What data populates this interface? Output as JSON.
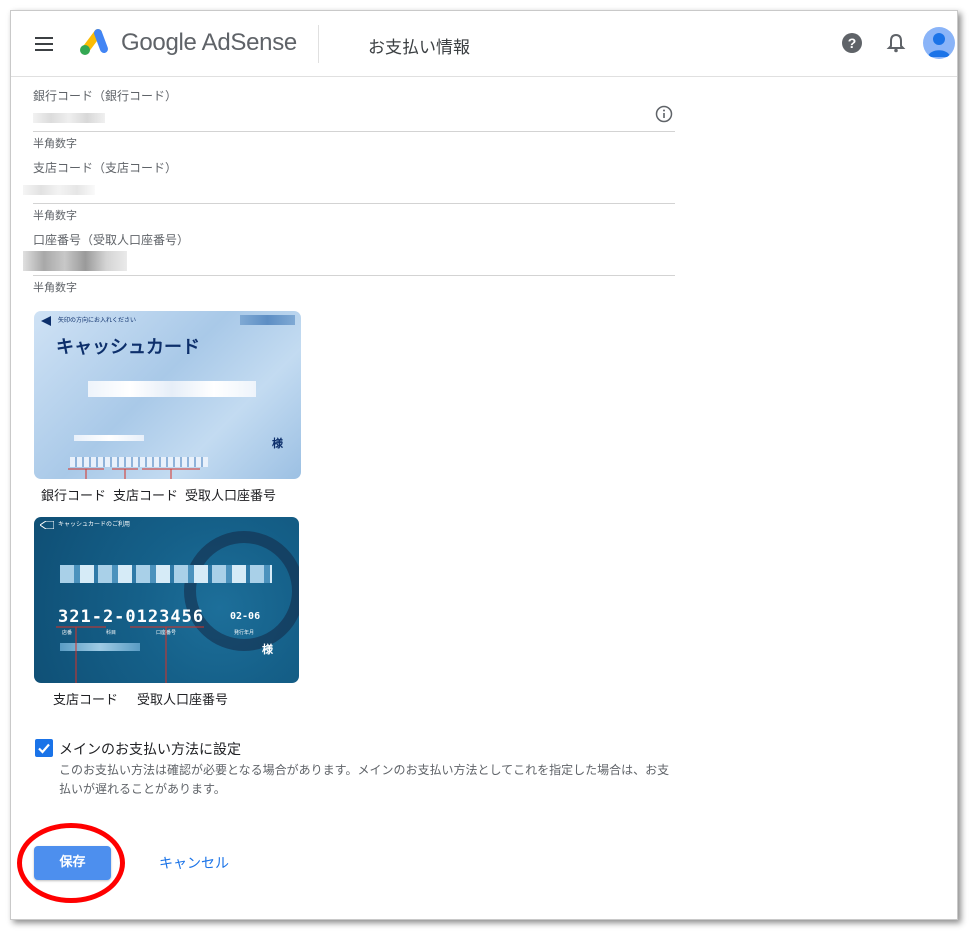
{
  "header": {
    "brand": "Google AdSense",
    "page_title": "お支払い情報"
  },
  "form": {
    "bank_code": {
      "label": "銀行コード（銀行コード）",
      "hint": "半角数字"
    },
    "branch_code": {
      "label": "支店コード（支店コード）",
      "hint": "半角数字"
    },
    "account_number": {
      "label": "口座番号（受取人口座番号）",
      "hint": "半角数字"
    }
  },
  "card_front": {
    "instruction": "矢印の方向にお入れください",
    "title": "キャッシュカード",
    "suffix": "様",
    "captions": [
      "銀行コード",
      "支店コード",
      "受取人口座番号"
    ]
  },
  "card_back": {
    "header_text": "キャッシュカードのご利用",
    "number": "321-2-0123456",
    "expiry": "02-06",
    "small_labels": [
      "店番",
      "科目",
      "口座番号",
      "発行年月"
    ],
    "suffix": "様",
    "captions": [
      "支店コード",
      "受取人口座番号"
    ]
  },
  "primary_option": {
    "checked": true,
    "label": "メインのお支払い方法に設定",
    "description": "このお支払い方法は確認が必要となる場合があります。メインのお支払い方法としてこれを指定した場合は、お支払いが遅れることがあります。"
  },
  "actions": {
    "save_label": "保存",
    "cancel_label": "キャンセル"
  },
  "colors": {
    "accent": "#1a73e8",
    "save_button": "#4d8fee",
    "highlight_ring": "#ff0000"
  }
}
